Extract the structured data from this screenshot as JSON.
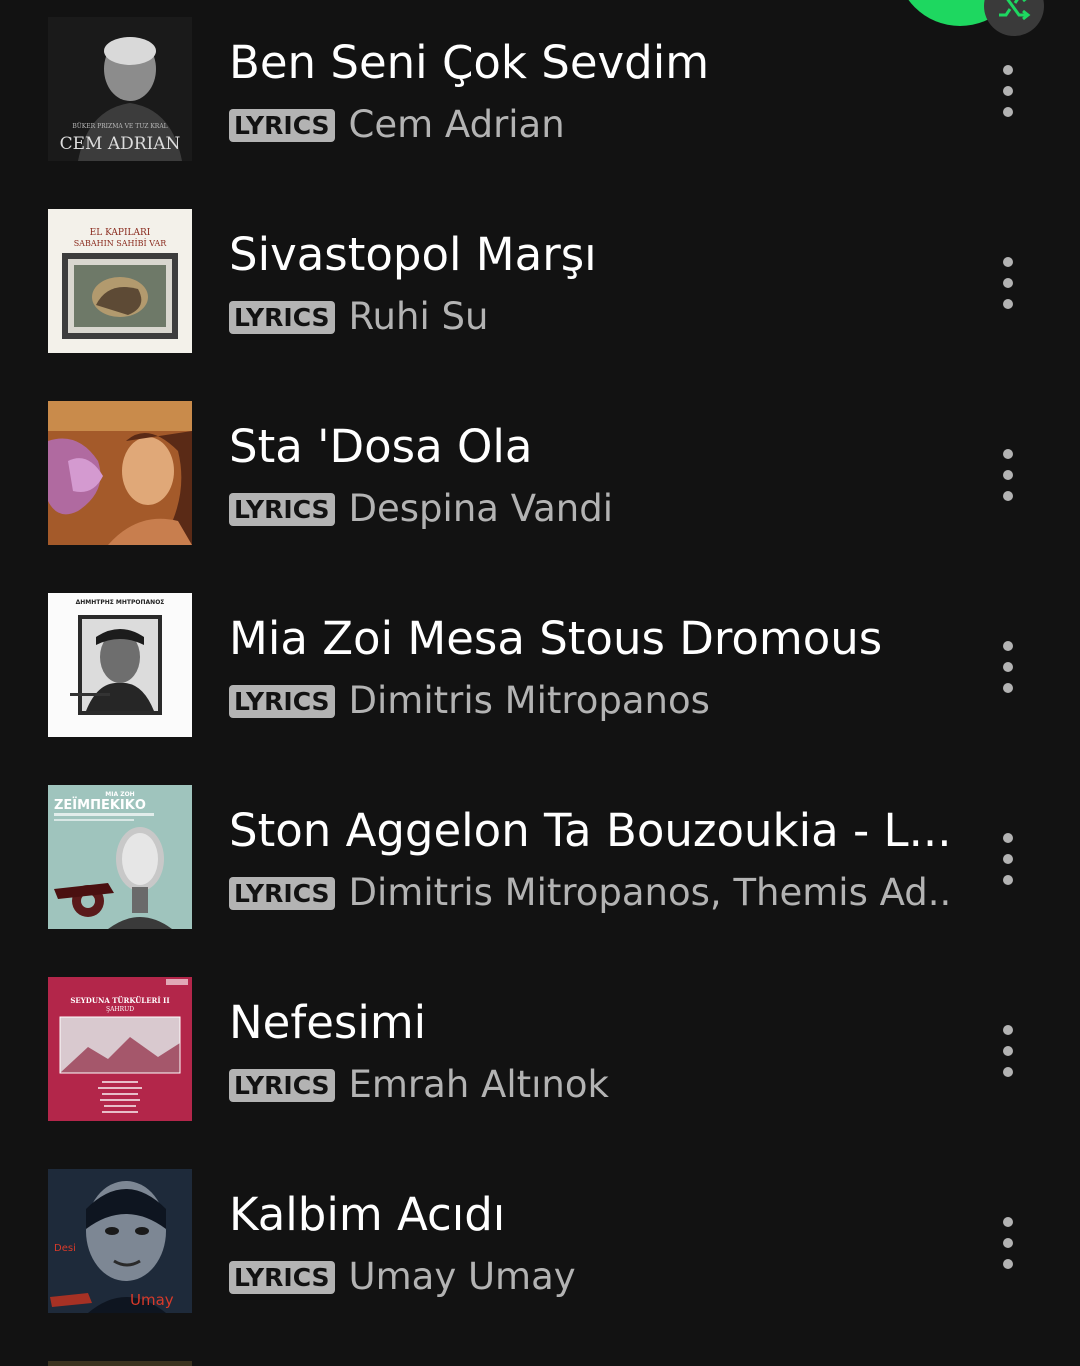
{
  "colors": {
    "background": "#121212",
    "accent": "#1ed760",
    "title": "#ffffff",
    "subtitle": "#b3b3b3"
  },
  "controls": {
    "play_button_icon": "play-icon",
    "shuffle_icon": "shuffle-icon"
  },
  "tracks": [
    {
      "title": "Ben Seni Çok Sevdim",
      "badge": "LYRICS",
      "artist": "Cem Adrian",
      "cover_text": "CEM ADRIAN",
      "cover_subtext": "BÜKER PRIZMA VE TUZ KRAL"
    },
    {
      "title": "Sivastopol Marşı",
      "badge": "LYRICS",
      "artist": "Ruhi Su",
      "cover_text": "EL KAPILARI",
      "cover_subtext": "SABAHIN SAHİBİ VAR"
    },
    {
      "title": "Sta 'Dosa Ola",
      "badge": "LYRICS",
      "artist": "Despina Vandi"
    },
    {
      "title": "Mia Zoi Mesa Stous Dromous",
      "badge": "LYRICS",
      "artist": "Dimitris Mitropanos",
      "cover_text": "ΔΗΜΗΤΡΗΣ ΜΗΤΡΟΠΑΝΟΣ"
    },
    {
      "title": "Ston Aggelon Ta Bouzoukia - L...",
      "badge": "LYRICS",
      "artist": "Dimitris Mitropanos, Themis Ad...",
      "cover_text": "ΖΕΪΜΠΕΚΙΚΟ",
      "cover_subtext": "MIA ZOH"
    },
    {
      "title": "Nefesimi",
      "badge": "LYRICS",
      "artist": "Emrah Altınok",
      "cover_text": "SEYDUNA TÜRKÜLERİ II",
      "cover_subtext": "ŞAHRUD"
    },
    {
      "title": "Kalbim Acıdı",
      "badge": "LYRICS",
      "artist": "Umay Umay",
      "cover_text": "Umay"
    }
  ]
}
